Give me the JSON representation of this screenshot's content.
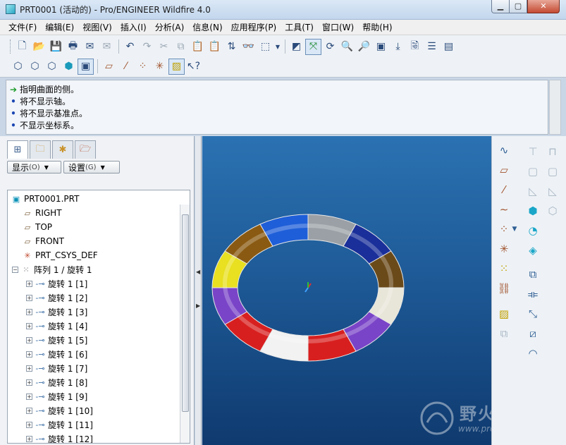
{
  "window": {
    "title": "PRT0001 (活动的) - Pro/ENGINEER Wildfire 4.0",
    "min_label": "▁",
    "max_label": "▢",
    "close_label": "✕"
  },
  "menu": [
    "文件(F)",
    "编辑(E)",
    "视图(V)",
    "插入(I)",
    "分析(A)",
    "信息(N)",
    "应用程序(P)",
    "工具(T)",
    "窗口(W)",
    "帮助(H)"
  ],
  "messages": [
    {
      "marker": "arrow",
      "text": "指明曲面的侧。"
    },
    {
      "marker": "dot",
      "text": "将不显示轴。"
    },
    {
      "marker": "dot",
      "text": "将不显示基准点。"
    },
    {
      "marker": "dot",
      "text": "不显示坐标系。"
    }
  ],
  "navigator": {
    "show_label": "显示",
    "show_key": "(O)",
    "settings_label": "设置",
    "settings_key": "(G)"
  },
  "tree": {
    "root": "PRT0001.PRT",
    "datums": [
      "RIGHT",
      "TOP",
      "FRONT",
      "PRT_CSYS_DEF"
    ],
    "pattern": "阵列 1 / 旋转 1",
    "features": [
      "旋转 1 [1]",
      "旋转 1 [2]",
      "旋转 1 [3]",
      "旋转 1 [4]",
      "旋转 1 [5]",
      "旋转 1 [6]",
      "旋转 1 [7]",
      "旋转 1 [8]",
      "旋转 1 [9]",
      "旋转 1 [10]",
      "旋转 1 [11]",
      "旋转 1 [12]"
    ]
  },
  "model": {
    "segment_colors": [
      "#9aa0a6",
      "#1a2f9a",
      "#6b4a1a",
      "#e8e6d8",
      "#7a44c8",
      "#d81f1f",
      "#f2f2f2",
      "#d81f1f",
      "#7a44c8",
      "#e8e020",
      "#8a5a12",
      "#1e5ed8"
    ]
  },
  "watermark": {
    "site": "野火论坛",
    "url": "www.proewildfire.cn"
  },
  "colors": {
    "viewport_top": "#2b72b2",
    "viewport_bottom": "#0f3a6f"
  }
}
